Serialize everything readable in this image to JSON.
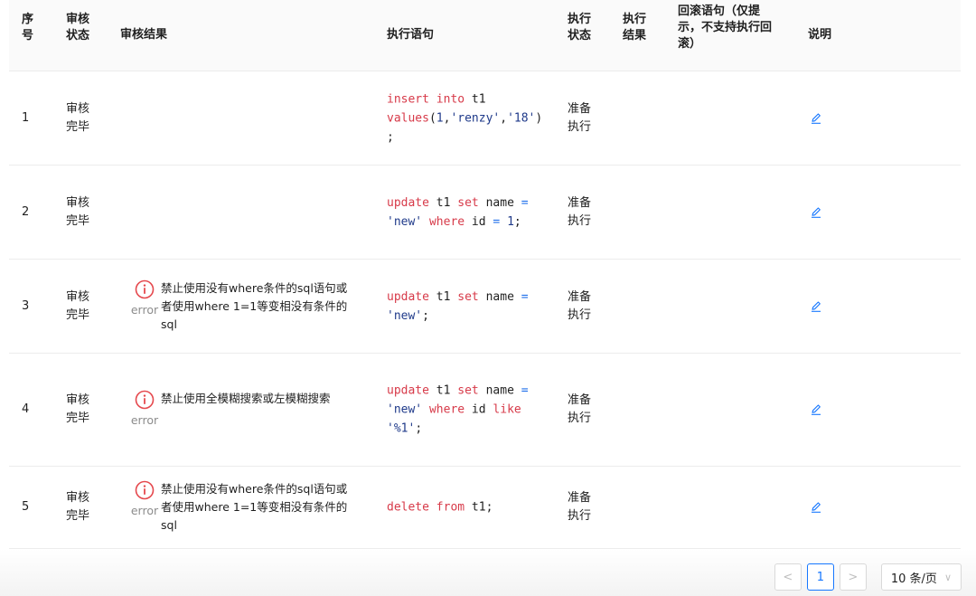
{
  "headers": {
    "seq": "序号",
    "audit_status": "审核状态",
    "audit_result": "审核结果",
    "statement": "执行语句",
    "exec_status": "执行状态",
    "exec_result": "执行结果",
    "rollback": "回滚语句（仅提示，不支持执行回滚）",
    "description": "说明"
  },
  "header_lines": {
    "seq": [
      "序",
      "号"
    ],
    "audit_status": [
      "审核",
      "状态"
    ],
    "exec_status": [
      "执行",
      "状态"
    ],
    "exec_result": [
      "执行",
      "结果"
    ],
    "rollback": [
      "回滚语句（仅提",
      "示，不支持执行回",
      "滚）"
    ]
  },
  "rows": [
    {
      "index": "1",
      "audit_status": [
        "审核",
        "完毕"
      ],
      "result_level": "",
      "result_message": "",
      "sql_tokens": [
        {
          "t": "insert",
          "c": "kw"
        },
        {
          "t": " ",
          "c": "plain"
        },
        {
          "t": "into",
          "c": "kw"
        },
        {
          "t": " t1\n",
          "c": "plain"
        },
        {
          "t": "values",
          "c": "kw"
        },
        {
          "t": "(",
          "c": "plain"
        },
        {
          "t": "1",
          "c": "num"
        },
        {
          "t": ",",
          "c": "plain"
        },
        {
          "t": "'renzy'",
          "c": "str"
        },
        {
          "t": ",",
          "c": "plain"
        },
        {
          "t": "'18'",
          "c": "str"
        },
        {
          "t": ")\n;",
          "c": "plain"
        }
      ],
      "exec_status": [
        "准备",
        "执行"
      ]
    },
    {
      "index": "2",
      "audit_status": [
        "审核",
        "完毕"
      ],
      "result_level": "",
      "result_message": "",
      "sql_tokens": [
        {
          "t": "update",
          "c": "kw"
        },
        {
          "t": " t1 ",
          "c": "plain"
        },
        {
          "t": "set",
          "c": "kw"
        },
        {
          "t": " name ",
          "c": "plain"
        },
        {
          "t": "=",
          "c": "op"
        },
        {
          "t": "\n",
          "c": "plain"
        },
        {
          "t": "'new'",
          "c": "str"
        },
        {
          "t": " ",
          "c": "plain"
        },
        {
          "t": "where",
          "c": "kw"
        },
        {
          "t": " id ",
          "c": "plain"
        },
        {
          "t": "=",
          "c": "op"
        },
        {
          "t": " ",
          "c": "plain"
        },
        {
          "t": "1",
          "c": "num"
        },
        {
          "t": ";",
          "c": "plain"
        }
      ],
      "exec_status": [
        "准备",
        "执行"
      ]
    },
    {
      "index": "3",
      "audit_status": [
        "审核",
        "完毕"
      ],
      "result_level": "error",
      "result_message": "禁止使用没有where条件的sql语句或者使用where 1=1等变相没有条件的sql",
      "sql_tokens": [
        {
          "t": "update",
          "c": "kw"
        },
        {
          "t": " t1 ",
          "c": "plain"
        },
        {
          "t": "set",
          "c": "kw"
        },
        {
          "t": " name ",
          "c": "plain"
        },
        {
          "t": "=",
          "c": "op"
        },
        {
          "t": "\n",
          "c": "plain"
        },
        {
          "t": "'new'",
          "c": "str"
        },
        {
          "t": ";",
          "c": "plain"
        }
      ],
      "exec_status": [
        "准备",
        "执行"
      ]
    },
    {
      "index": "4",
      "audit_status": [
        "审核",
        "完毕"
      ],
      "result_level": "error",
      "result_message": "禁止使用全模糊搜索或左模糊搜索",
      "sql_tokens": [
        {
          "t": "update",
          "c": "kw"
        },
        {
          "t": " t1 ",
          "c": "plain"
        },
        {
          "t": "set",
          "c": "kw"
        },
        {
          "t": " name ",
          "c": "plain"
        },
        {
          "t": "=",
          "c": "op"
        },
        {
          "t": "\n",
          "c": "plain"
        },
        {
          "t": "'new'",
          "c": "str"
        },
        {
          "t": " ",
          "c": "plain"
        },
        {
          "t": "where",
          "c": "kw"
        },
        {
          "t": " id ",
          "c": "plain"
        },
        {
          "t": "like",
          "c": "kw"
        },
        {
          "t": "\n",
          "c": "plain"
        },
        {
          "t": "'%1'",
          "c": "str"
        },
        {
          "t": ";",
          "c": "plain"
        }
      ],
      "exec_status": [
        "准备",
        "执行"
      ]
    },
    {
      "index": "5",
      "audit_status": [
        "审核",
        "完毕"
      ],
      "result_level": "error",
      "result_message": "禁止使用没有where条件的sql语句或者使用where 1=1等变相没有条件的sql",
      "sql_tokens": [
        {
          "t": "delete",
          "c": "kw"
        },
        {
          "t": " ",
          "c": "plain"
        },
        {
          "t": "from",
          "c": "kw"
        },
        {
          "t": " t1;",
          "c": "plain"
        }
      ],
      "exec_status": [
        "准备",
        "执行"
      ]
    }
  ],
  "pagination": {
    "prev": "<",
    "current": "1",
    "next": ">",
    "page_size": "10 条/页",
    "size_chevron": "∨"
  },
  "colors": {
    "error": "#e5484d",
    "link": "#1677ff",
    "keyword": "#d73a49",
    "string": "#1f3a8a"
  },
  "icons": {
    "error": "exclamation-circle-icon",
    "edit": "edit-pencil-icon"
  }
}
